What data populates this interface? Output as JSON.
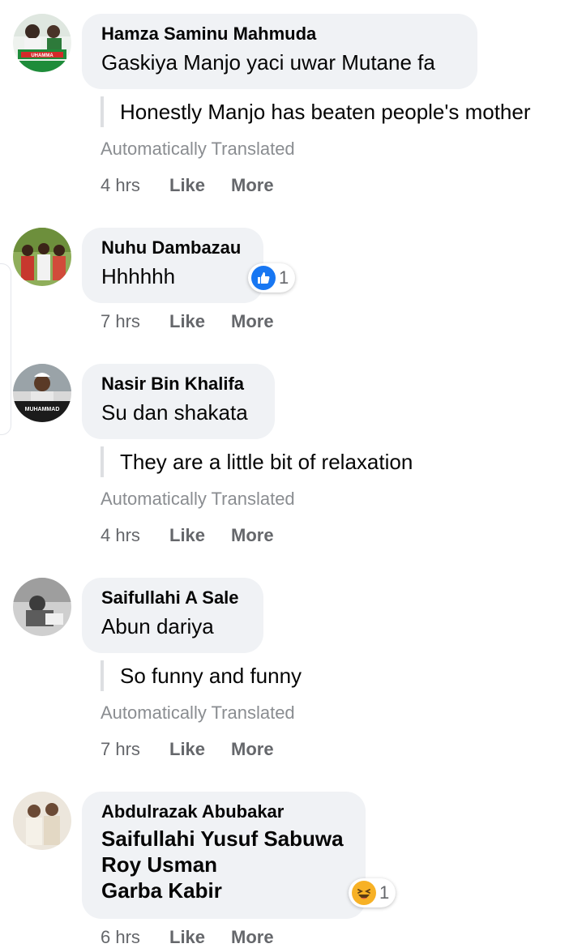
{
  "comments": [
    {
      "author": "Hamza Saminu Mahmuda",
      "text": "Gaskiya Manjo yaci uwar Mutane fa",
      "translation": "Honestly Manjo has beaten people's mother",
      "auto_label": "Automatically Translated",
      "time": "4 hrs",
      "like_label": "Like",
      "more_label": "More"
    },
    {
      "author": "Nuhu Dambazau",
      "text": "Hhhhhh",
      "time": "7 hrs",
      "like_label": "Like",
      "more_label": "More",
      "reaction": {
        "type": "like",
        "count": "1"
      }
    },
    {
      "author": "Nasir Bin Khalifa",
      "text": "Su dan shakata",
      "translation": "They are a little bit of relaxation",
      "auto_label": "Automatically Translated",
      "time": "4 hrs",
      "like_label": "Like",
      "more_label": "More"
    },
    {
      "author": "Saifullahi A Sale",
      "text": "Abun dariya",
      "translation": "So funny and funny",
      "auto_label": "Automatically Translated",
      "time": "7 hrs",
      "like_label": "Like",
      "more_label": "More"
    },
    {
      "author": "Abdulrazak Abubakar",
      "tags": [
        "Saifullahi Yusuf Sabuwa",
        "Roy Usman",
        "Garba Kabir"
      ],
      "time": "6 hrs",
      "like_label": "Like",
      "more_label": "More",
      "reaction": {
        "type": "haha",
        "count": "1"
      }
    }
  ],
  "avatar_texts": {
    "c1": "UHAMMA",
    "c3": "MUHAMMAD"
  },
  "colors": {
    "bubble": "#f0f2f5",
    "secondary_text": "#65676b",
    "translated_label": "#8a8d91",
    "like_blue": "#1877f2",
    "haha_yellow": "#f7b125"
  }
}
